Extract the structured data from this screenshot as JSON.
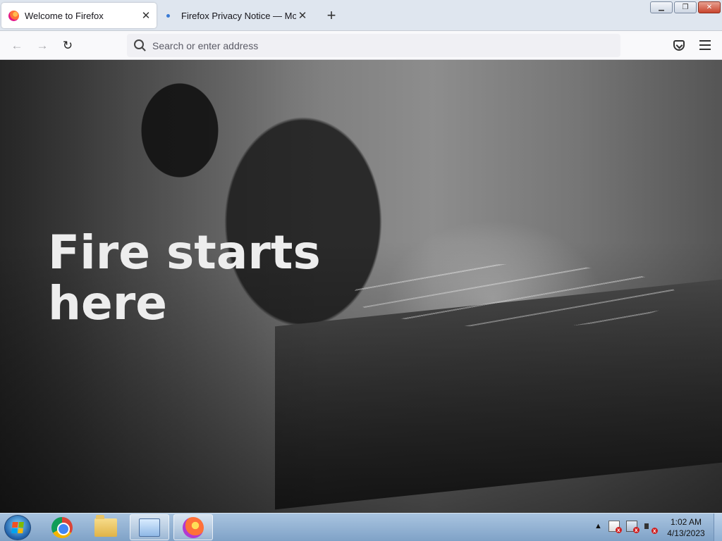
{
  "window": {
    "tabs": [
      {
        "label": "Welcome to Firefox",
        "active": true
      },
      {
        "label": "Firefox Privacy Notice — Mozilla",
        "active": false
      }
    ],
    "new_tab_symbol": "+",
    "close_symbol": "✕",
    "minimize_symbol": "▁",
    "maximize_symbol": "❐",
    "window_close_symbol": "✕"
  },
  "navbar": {
    "back_symbol": "←",
    "forward_symbol": "→",
    "reload_symbol": "↻",
    "search_placeholder": "Search or enter address",
    "pocket_icon": "pocket-icon",
    "menu_icon": "hamburger-menu-icon"
  },
  "content": {
    "headline": "Fire starts here"
  },
  "taskbar": {
    "apps": [
      {
        "name": "Google Chrome",
        "icon": "chrome-icon"
      },
      {
        "name": "Windows Explorer",
        "icon": "folder-icon"
      },
      {
        "name": "Control Panel",
        "icon": "control-panel-icon"
      },
      {
        "name": "Firefox",
        "icon": "firefox-icon"
      }
    ],
    "tray_expand_symbol": "▲",
    "clock_time": "1:02 AM",
    "clock_date": "4/13/2023"
  },
  "colors": {
    "tabstrip_bg": "#dfe6ef",
    "navbar_bg": "#f9f9fb",
    "urlbar_bg": "#f0f0f4",
    "headline_color": "#ededed",
    "taskbar_bg": "#7fa2c7"
  }
}
